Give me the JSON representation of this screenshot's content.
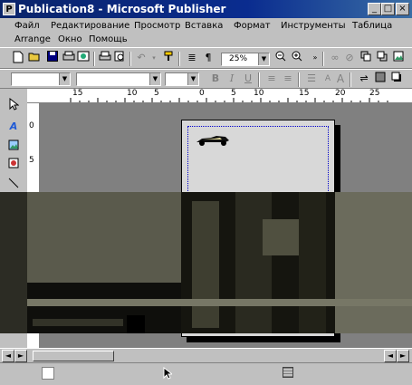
{
  "window": {
    "app_icon": "P",
    "title": "Publication8 - Microsoft Publisher",
    "minimize": "_",
    "maximize": "□",
    "close": "×"
  },
  "menu": {
    "items": [
      "Файл",
      "Редактирование",
      "Просмотр",
      "Вставка",
      "Формат",
      "Инструменты",
      "Таблица",
      "Аrrange",
      "Окно",
      "Помощь"
    ]
  },
  "toolbar": {
    "zoom": "25%"
  },
  "ruler": {
    "h_ticks": [
      "15",
      "10",
      "5",
      "0",
      "5",
      "10",
      "15",
      "20",
      "25"
    ],
    "v_ticks": [
      "0",
      "5"
    ]
  },
  "icons": {
    "new": "new-document-icon",
    "open": "open-icon",
    "save": "save-icon",
    "print": "print-icon",
    "undo": "undo-icon",
    "zoom_out": "zoom-out-icon",
    "zoom_in": "zoom-in-icon",
    "text_tool": "text-frame-icon",
    "picture": "picture-icon",
    "line": "line-icon"
  },
  "colors": {
    "title_bar": "#0a246a",
    "face": "#c0c0c0",
    "workspace": "#808080"
  }
}
